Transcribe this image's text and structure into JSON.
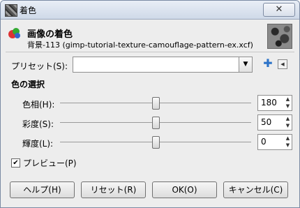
{
  "window": {
    "title": "着色",
    "close_label": "✕"
  },
  "header": {
    "title": "画像の着色",
    "subtitle": "背景-113 (gimp-tutorial-texture-camouflage-pattern-ex.xcf)"
  },
  "preset": {
    "label": "プリセット(S):",
    "value": ""
  },
  "colors_section": {
    "title": "色の選択",
    "rows": [
      {
        "label": "色相(H):",
        "value": "180",
        "level": 0.5
      },
      {
        "label": "彩度(S):",
        "value": "50",
        "level": 0.5
      },
      {
        "label": "輝度(L):",
        "value": "0",
        "level": 0.5
      }
    ]
  },
  "preview": {
    "label": "プレビュー(P)",
    "checked": true
  },
  "buttons": {
    "help": "ヘルプ(H)",
    "reset": "リセット(R)",
    "ok": "OK(O)",
    "cancel": "キャンセル(C)"
  },
  "icons": {
    "add": "plus-icon",
    "menu": "menu-arrow-icon",
    "dropdown": "chevron-down-icon",
    "spin_up": "spin-up-icon",
    "spin_down": "spin-down-icon"
  },
  "accent_color": "#2d73c8"
}
